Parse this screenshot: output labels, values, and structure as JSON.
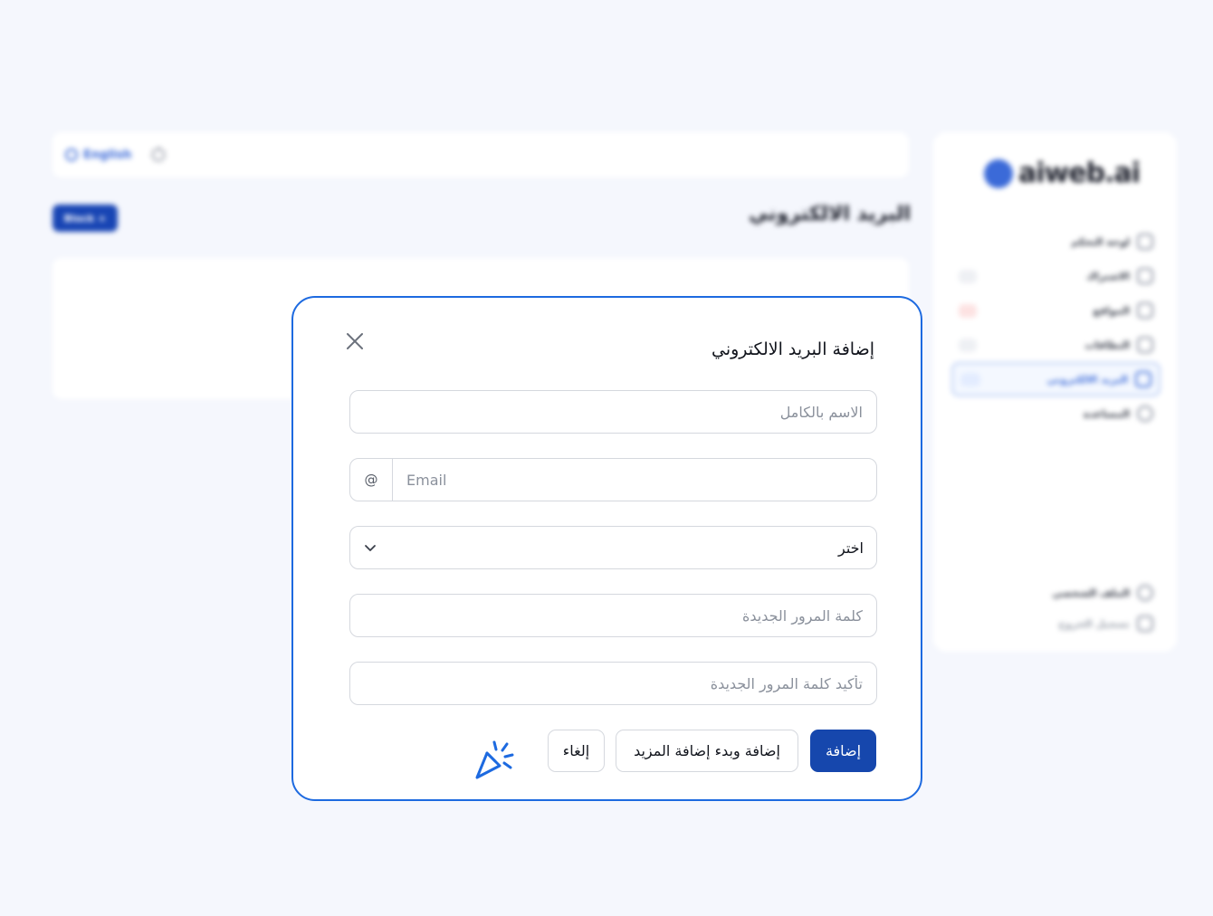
{
  "background": {
    "topbar": {
      "language": "English"
    },
    "page_title": "البريد الالكتروني",
    "action_button": "Block +",
    "logo": "aiweb.ai",
    "sidebar": {
      "items": [
        {
          "label": "لوحة التحكم",
          "badge": ""
        },
        {
          "label": "الاشتراك",
          "badge": "",
          "badge_style": "gray"
        },
        {
          "label": "المواقع",
          "badge": "",
          "badge_style": "red"
        },
        {
          "label": "النطاقات",
          "badge": "",
          "badge_style": "gray"
        },
        {
          "label": "البريد الالكتروني",
          "badge": "",
          "badge_style": "blue",
          "active": true
        },
        {
          "label": "المساعدة",
          "badge": ""
        }
      ],
      "bottom": [
        {
          "label": "الملف الشخصي"
        },
        {
          "label": "تسجيل الخروج"
        }
      ]
    }
  },
  "modal": {
    "title": "إضافة البريد الالكتروني",
    "fields": {
      "full_name_placeholder": "الاسم بالكامل",
      "email_prefix": "@",
      "email_placeholder": "Email",
      "select_value": "اختر",
      "new_password_placeholder": "كلمة المرور الجديدة",
      "confirm_password_placeholder": "تأكيد كلمة المرور الجديدة"
    },
    "buttons": {
      "add": "إضافة",
      "add_and_more": "إضافة وبدء إضافة المزيد",
      "cancel": "إلغاء"
    },
    "icons": {
      "close": "close-icon",
      "cursor": "click-cursor-icon",
      "chevron": "chevron-down-icon"
    }
  },
  "colors": {
    "accent": "#1d6ae0",
    "primary_button": "#1647ad",
    "page_bg": "#f5f7fd"
  }
}
